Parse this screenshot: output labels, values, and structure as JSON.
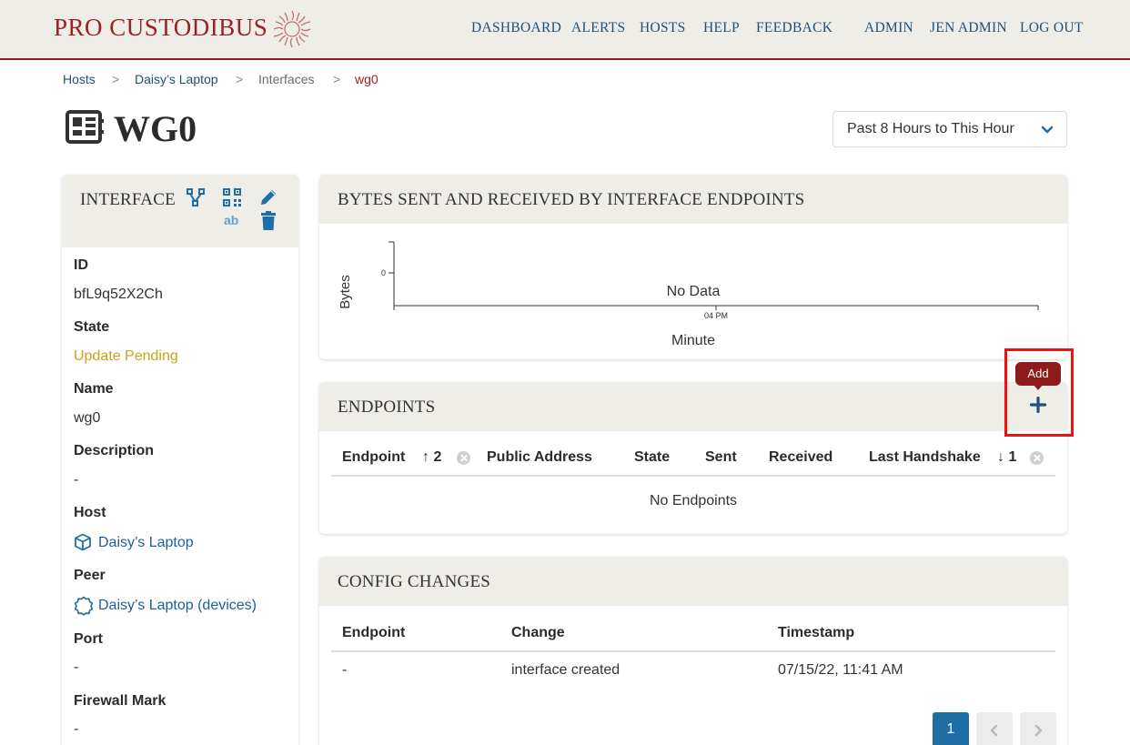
{
  "header": {
    "brand": "PRO CUSTODIBUS",
    "nav": {
      "dashboard": "DASHBOARD",
      "alerts": "ALERTS",
      "hosts": "HOSTS",
      "help": "HELP",
      "feedback": "FEEDBACK",
      "admin": "ADMIN",
      "user": "JEN ADMIN",
      "logout": "LOG OUT"
    }
  },
  "breadcrumb": {
    "hosts": "Hosts",
    "host": "Daisy’s Laptop",
    "interfaces": "Interfaces",
    "current": "wg0",
    "separator": ">"
  },
  "page": {
    "title": "WG0",
    "time_range": "Past 8 Hours to This Hour"
  },
  "interface_card": {
    "title": "INTERFACE",
    "qr_label": "ab",
    "fields": {
      "id_label": "ID",
      "id_value": "bfL9q52X2Ch",
      "state_label": "State",
      "state_value": "Update Pending",
      "name_label": "Name",
      "name_value": "wg0",
      "description_label": "Description",
      "description_value": "-",
      "host_label": "Host",
      "host_value": "Daisy’s Laptop",
      "peer_label": "Peer",
      "peer_value": "Daisy’s Laptop (devices)",
      "port_label": "Port",
      "port_value": "-",
      "fwmark_label": "Firewall Mark",
      "fwmark_value": "-"
    }
  },
  "chart_card": {
    "title": "BYTES SENT AND RECEIVED BY INTERFACE ENDPOINTS"
  },
  "chart_data": {
    "type": "line",
    "title": "",
    "xlabel": "Minute",
    "ylabel": "Bytes",
    "x_ticks": [
      "04 PM"
    ],
    "y_ticks": [
      "0"
    ],
    "series": [],
    "empty_message": "No Data",
    "grid": false
  },
  "endpoints_card": {
    "title": "ENDPOINTS",
    "add_tooltip": "Add",
    "columns": {
      "endpoint": "Endpoint",
      "endpoint_sort": "↑ 2",
      "public_address": "Public Address",
      "state": "State",
      "sent": "Sent",
      "received": "Received",
      "last_handshake": "Last Handshake",
      "last_handshake_sort": "↓ 1"
    },
    "empty_message": "No Endpoints"
  },
  "config_card": {
    "title": "CONFIG CHANGES",
    "columns": {
      "endpoint": "Endpoint",
      "change": "Change",
      "timestamp": "Timestamp"
    },
    "rows": [
      {
        "endpoint": "-",
        "change": "interface created",
        "timestamp": "07/15/22, 11:41 AM"
      }
    ],
    "pagination": {
      "current_page": "1"
    }
  },
  "colors": {
    "brand_red": "#9b2222",
    "link_blue": "#1f4f7a",
    "icon_blue": "#1f6fa6",
    "pending_yellow": "#c9a21b",
    "panel_beige": "#efede8"
  }
}
